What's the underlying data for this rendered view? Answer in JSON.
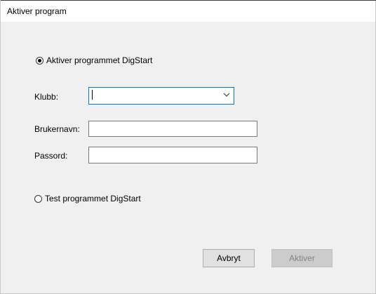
{
  "window": {
    "title": "Aktiver program"
  },
  "options": {
    "activate_label": "Aktiver programmet DigStart",
    "activate_selected": true,
    "test_label": "Test programmet DigStart",
    "test_selected": false
  },
  "form": {
    "club_label": "Klubb:",
    "club_value": "",
    "username_label": "Brukernavn:",
    "username_value": "",
    "password_label": "Passord:",
    "password_value": ""
  },
  "buttons": {
    "cancel_label": "Avbryt",
    "activate_label": "Aktiver"
  },
  "icons": {
    "dropdown": "chevron-down-icon"
  },
  "colors": {
    "focus_accent": "#0078d7",
    "dialog_background": "#f0f0f0",
    "disabled_text": "#838383"
  }
}
